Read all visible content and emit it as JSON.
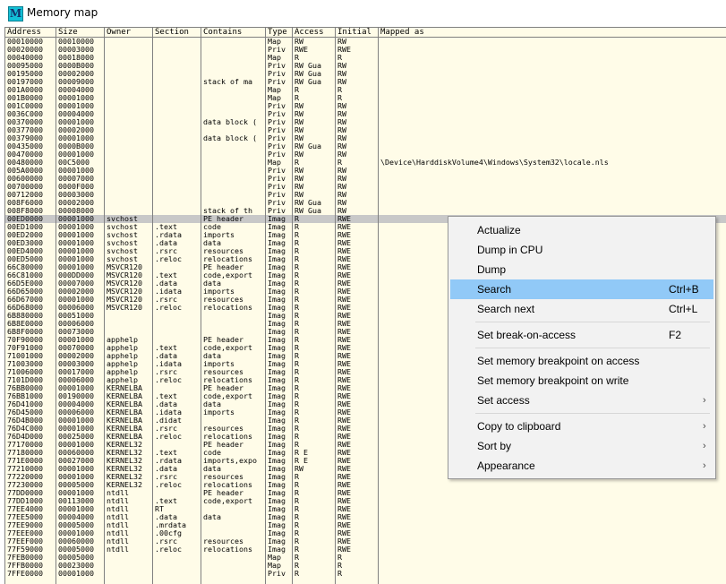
{
  "window": {
    "title": "Memory map",
    "icon_letter": "M"
  },
  "columns": [
    "Address",
    "Size",
    "Owner",
    "Section",
    "Contains",
    "Type",
    "Access",
    "Initial",
    "Mapped as"
  ],
  "rows": [
    [
      "00010000",
      "00010000",
      "",
      "",
      "",
      "Map",
      "RW",
      "RW",
      ""
    ],
    [
      "00020000",
      "00003000",
      "",
      "",
      "",
      "Priv",
      "RWE",
      "RWE",
      ""
    ],
    [
      "00040000",
      "00018000",
      "",
      "",
      "",
      "Map",
      "R",
      "R",
      ""
    ],
    [
      "00095000",
      "0000B000",
      "",
      "",
      "",
      "Priv",
      "RW  Gua",
      "RW",
      ""
    ],
    [
      "00195000",
      "00002000",
      "",
      "",
      "",
      "Priv",
      "RW  Gua",
      "RW",
      ""
    ],
    [
      "00197000",
      "00009000",
      "",
      "",
      "stack of ma",
      "Priv",
      "RW  Gua",
      "RW",
      ""
    ],
    [
      "001A0000",
      "00004000",
      "",
      "",
      "",
      "Map",
      "R",
      "R",
      ""
    ],
    [
      "001B0000",
      "00001000",
      "",
      "",
      "",
      "Map",
      "R",
      "R",
      ""
    ],
    [
      "001C0000",
      "00001000",
      "",
      "",
      "",
      "Priv",
      "RW",
      "RW",
      ""
    ],
    [
      "0036C000",
      "00004000",
      "",
      "",
      "",
      "Priv",
      "RW",
      "RW",
      ""
    ],
    [
      "00370000",
      "00001000",
      "",
      "",
      "data block (",
      "Priv",
      "RW",
      "RW",
      ""
    ],
    [
      "00377000",
      "00002000",
      "",
      "",
      "",
      "Priv",
      "RW",
      "RW",
      ""
    ],
    [
      "00379000",
      "00001000",
      "",
      "",
      "data block (",
      "Priv",
      "RW",
      "RW",
      ""
    ],
    [
      "00435000",
      "0000B000",
      "",
      "",
      "",
      "Priv",
      "RW  Gua",
      "RW",
      ""
    ],
    [
      "00470000",
      "00001000",
      "",
      "",
      "",
      "Priv",
      "RW",
      "RW",
      ""
    ],
    [
      "00480000",
      "00C5000",
      "",
      "",
      "",
      "Map",
      "R",
      "R",
      "\\Device\\HarddiskVolume4\\Windows\\System32\\locale.nls"
    ],
    [
      "005A0000",
      "00001000",
      "",
      "",
      "",
      "Priv",
      "RW",
      "RW",
      ""
    ],
    [
      "00600000",
      "00007000",
      "",
      "",
      "",
      "Priv",
      "RW",
      "RW",
      ""
    ],
    [
      "00700000",
      "0000F000",
      "",
      "",
      "",
      "Priv",
      "RW",
      "RW",
      ""
    ],
    [
      "00712000",
      "00003000",
      "",
      "",
      "",
      "Priv",
      "RW",
      "RW",
      ""
    ],
    [
      "008F6000",
      "00002000",
      "",
      "",
      "",
      "Priv",
      "RW  Gua",
      "RW",
      ""
    ],
    [
      "008F8000",
      "00008000",
      "",
      "",
      "stack of th",
      "Priv",
      "RW  Gua",
      "RW",
      ""
    ],
    [
      "00ED0000",
      "00001000",
      "svchost",
      "",
      "PE header",
      "Imag",
      "R",
      "RWE",
      ""
    ],
    [
      "00ED1000",
      "00001000",
      "svchost",
      ".text",
      "code",
      "Imag",
      "R",
      "RWE",
      ""
    ],
    [
      "00ED2000",
      "00001000",
      "svchost",
      ".rdata",
      "imports",
      "Imag",
      "R",
      "RWE",
      ""
    ],
    [
      "00ED3000",
      "00001000",
      "svchost",
      ".data",
      "data",
      "Imag",
      "R",
      "RWE",
      ""
    ],
    [
      "00ED4000",
      "00001000",
      "svchost",
      ".rsrc",
      "resources",
      "Imag",
      "R",
      "RWE",
      ""
    ],
    [
      "00ED5000",
      "00001000",
      "svchost",
      ".reloc",
      "relocations",
      "Imag",
      "R",
      "RWE",
      ""
    ],
    [
      "66C80000",
      "00001000",
      "MSVCR120",
      "",
      "PE header",
      "Imag",
      "R",
      "RWE",
      ""
    ],
    [
      "66C81000",
      "000DD000",
      "MSVCR120",
      ".text",
      "code,export",
      "Imag",
      "R",
      "RWE",
      ""
    ],
    [
      "66D5E000",
      "00007000",
      "MSVCR120",
      ".data",
      "data",
      "Imag",
      "R",
      "RWE",
      ""
    ],
    [
      "66D65000",
      "00002000",
      "MSVCR120",
      ".idata",
      "imports",
      "Imag",
      "R",
      "RWE",
      ""
    ],
    [
      "66D67000",
      "00001000",
      "MSVCR120",
      ".rsrc",
      "resources",
      "Imag",
      "R",
      "RWE",
      ""
    ],
    [
      "66D68000",
      "00006000",
      "MSVCR120",
      ".reloc",
      "relocations",
      "Imag",
      "R",
      "RWE",
      ""
    ],
    [
      "6B880000",
      "00051000",
      "",
      "",
      "",
      "Imag",
      "R",
      "RWE",
      ""
    ],
    [
      "6B8E0000",
      "00006000",
      "",
      "",
      "",
      "Imag",
      "R",
      "RWE",
      ""
    ],
    [
      "6B8F0000",
      "00073000",
      "",
      "",
      "",
      "Imag",
      "R",
      "RWE",
      ""
    ],
    [
      "70F90000",
      "00001000",
      "apphelp",
      "",
      "PE header",
      "Imag",
      "R",
      "RWE",
      ""
    ],
    [
      "70F91000",
      "00070000",
      "apphelp",
      ".text",
      "code,export",
      "Imag",
      "R",
      "RWE",
      ""
    ],
    [
      "71001000",
      "00002000",
      "apphelp",
      ".data",
      "data",
      "Imag",
      "R",
      "RWE",
      ""
    ],
    [
      "71003000",
      "00003000",
      "apphelp",
      ".idata",
      "imports",
      "Imag",
      "R",
      "RWE",
      ""
    ],
    [
      "71006000",
      "00017000",
      "apphelp",
      ".rsrc",
      "resources",
      "Imag",
      "R",
      "RWE",
      ""
    ],
    [
      "7101D000",
      "00006000",
      "apphelp",
      ".reloc",
      "relocations",
      "Imag",
      "R",
      "RWE",
      ""
    ],
    [
      "76BB0000",
      "00001000",
      "KERNELBA",
      "",
      "PE header",
      "Imag",
      "R",
      "RWE",
      ""
    ],
    [
      "76BB1000",
      "00190000",
      "KERNELBA",
      ".text",
      "code,export",
      "Imag",
      "R",
      "RWE",
      ""
    ],
    [
      "76D41000",
      "00004000",
      "KERNELBA",
      ".data",
      "data",
      "Imag",
      "R",
      "RWE",
      ""
    ],
    [
      "76D45000",
      "00006000",
      "KERNELBA",
      ".idata",
      "imports",
      "Imag",
      "R",
      "RWE",
      ""
    ],
    [
      "76D4B000",
      "00001000",
      "KERNELBA",
      ".didat",
      "",
      "Imag",
      "R",
      "RWE",
      ""
    ],
    [
      "76D4C000",
      "00001000",
      "KERNELBA",
      ".rsrc",
      "resources",
      "Imag",
      "R",
      "RWE",
      ""
    ],
    [
      "76D4D000",
      "00025000",
      "KERNELBA",
      ".reloc",
      "relocations",
      "Imag",
      "R",
      "RWE",
      ""
    ],
    [
      "77170000",
      "00001000",
      "KERNEL32",
      "",
      "PE header",
      "Imag",
      "R",
      "RWE",
      ""
    ],
    [
      "77180000",
      "00060000",
      "KERNEL32",
      ".text",
      "code",
      "Imag",
      "R E",
      "RWE",
      ""
    ],
    [
      "771E0000",
      "00027000",
      "KERNEL32",
      ".rdata",
      "imports,expo",
      "Imag",
      "R E",
      "RWE",
      ""
    ],
    [
      "77210000",
      "00001000",
      "KERNEL32",
      ".data",
      "data",
      "Imag",
      "RW",
      "RWE",
      ""
    ],
    [
      "77220000",
      "00001000",
      "KERNEL32",
      ".rsrc",
      "resources",
      "Imag",
      "R",
      "RWE",
      ""
    ],
    [
      "77230000",
      "00005000",
      "KERNEL32",
      ".reloc",
      "relocations",
      "Imag",
      "R",
      "RWE",
      ""
    ],
    [
      "77DD0000",
      "00001000",
      "ntdll",
      "",
      "PE header",
      "Imag",
      "R",
      "RWE",
      ""
    ],
    [
      "77DD1000",
      "00113000",
      "ntdll",
      ".text",
      "code,export",
      "Imag",
      "R",
      "RWE",
      ""
    ],
    [
      "77EE4000",
      "00001000",
      "ntdll",
      "RT",
      "",
      "Imag",
      "R",
      "RWE",
      ""
    ],
    [
      "77EE5000",
      "00004000",
      "ntdll",
      ".data",
      "data",
      "Imag",
      "R",
      "RWE",
      ""
    ],
    [
      "77EE9000",
      "00005000",
      "ntdll",
      ".mrdata",
      "",
      "Imag",
      "R",
      "RWE",
      ""
    ],
    [
      "77EEE000",
      "00001000",
      "ntdll",
      ".00cfg",
      "",
      "Imag",
      "R",
      "RWE",
      ""
    ],
    [
      "77EEF000",
      "00060000",
      "ntdll",
      ".rsrc",
      "resources",
      "Imag",
      "R",
      "RWE",
      ""
    ],
    [
      "77F59000",
      "00005000",
      "ntdll",
      ".reloc",
      "relocations",
      "Imag",
      "R",
      "RWE",
      ""
    ],
    [
      "7FEB0000",
      "00005000",
      "",
      "",
      "",
      "Map",
      "R",
      "R",
      ""
    ],
    [
      "7FFB0000",
      "00023000",
      "",
      "",
      "",
      "Map",
      "R",
      "R",
      ""
    ],
    [
      "7FFE0000",
      "00001000",
      "",
      "",
      "",
      "Priv",
      "R",
      "R",
      ""
    ]
  ],
  "selected_row": 22,
  "context_menu": {
    "items": [
      {
        "label": "Actualize",
        "shortcut": "",
        "submenu": false,
        "highlighted": false
      },
      {
        "label": "Dump in CPU",
        "shortcut": "",
        "submenu": false,
        "highlighted": false
      },
      {
        "label": "Dump",
        "shortcut": "",
        "submenu": false,
        "highlighted": false
      },
      {
        "label": "Search",
        "shortcut": "Ctrl+B",
        "submenu": false,
        "highlighted": true
      },
      {
        "label": "Search next",
        "shortcut": "Ctrl+L",
        "submenu": false,
        "highlighted": false
      },
      {
        "label": "Set break-on-access",
        "shortcut": "F2",
        "submenu": false,
        "highlighted": false
      },
      {
        "label": "Set memory breakpoint on access",
        "shortcut": "",
        "submenu": false,
        "highlighted": false
      },
      {
        "label": "Set memory breakpoint on write",
        "shortcut": "",
        "submenu": false,
        "highlighted": false
      },
      {
        "label": "Set access",
        "shortcut": "",
        "submenu": true,
        "highlighted": false
      },
      {
        "label": "Copy to clipboard",
        "shortcut": "",
        "submenu": true,
        "highlighted": false
      },
      {
        "label": "Sort by",
        "shortcut": "",
        "submenu": true,
        "highlighted": false
      },
      {
        "label": "Appearance",
        "shortcut": "",
        "submenu": true,
        "highlighted": false
      }
    ]
  },
  "colors": {
    "grid_background": "#fffce8",
    "selection": "#c8c8c8",
    "menu_highlight": "#91c9f7",
    "menu_background": "#f2f2f2",
    "icon": "#13bfd6"
  }
}
